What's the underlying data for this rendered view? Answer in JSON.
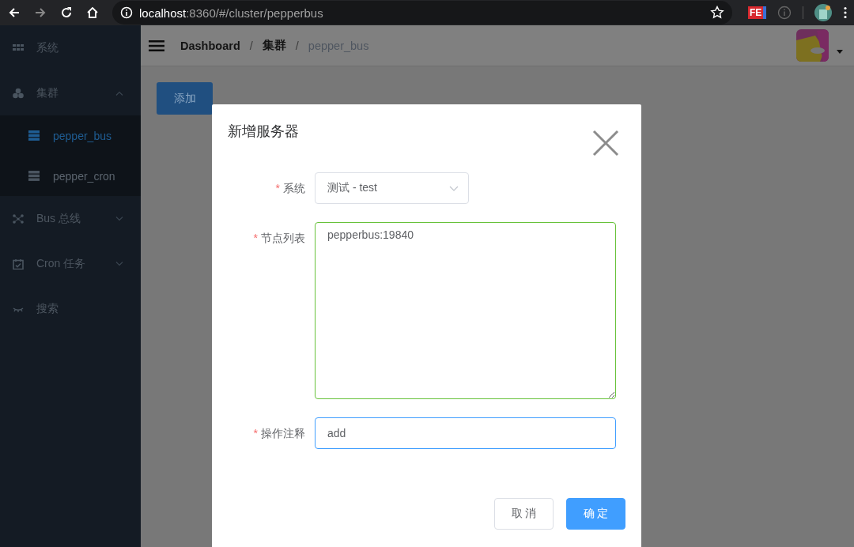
{
  "browser": {
    "url_host": "localhost",
    "url_path": ":8360/#/cluster/pepperbus",
    "extension_label": "FE"
  },
  "sidebar": {
    "items": [
      {
        "label": "系统"
      },
      {
        "label": "集群",
        "expanded": true,
        "children": [
          {
            "label": "pepper_bus",
            "selected": true
          },
          {
            "label": "pepper_cron",
            "selected": false
          }
        ]
      },
      {
        "label": "Bus 总线",
        "expanded": false
      },
      {
        "label": "Cron 任务",
        "expanded": false
      },
      {
        "label": "搜索"
      }
    ]
  },
  "header": {
    "breadcrumbs": [
      {
        "label": "Dashboard",
        "kind": "link"
      },
      {
        "separator": "/",
        "label": "集群",
        "kind": "link"
      },
      {
        "separator": "/",
        "label": "pepper_bus",
        "kind": "current"
      }
    ]
  },
  "add_button": {
    "label": "添加"
  },
  "dialog": {
    "title": "新增服务器",
    "fields": [
      {
        "required_mark": "*",
        "label": "系统",
        "kind": "select",
        "value": "测试 - test",
        "valid": false,
        "focused": false
      },
      {
        "required_mark": "*",
        "label": "节点列表",
        "kind": "textarea",
        "value": "pepperbus:19840",
        "valid": true,
        "focused": false
      },
      {
        "required_mark": "*",
        "label": "操作注释",
        "kind": "input",
        "value": "add",
        "valid": false,
        "focused": true
      }
    ],
    "buttons": [
      {
        "label": "取 消",
        "kind": "default"
      },
      {
        "label": "确 定",
        "kind": "primary"
      }
    ]
  }
}
